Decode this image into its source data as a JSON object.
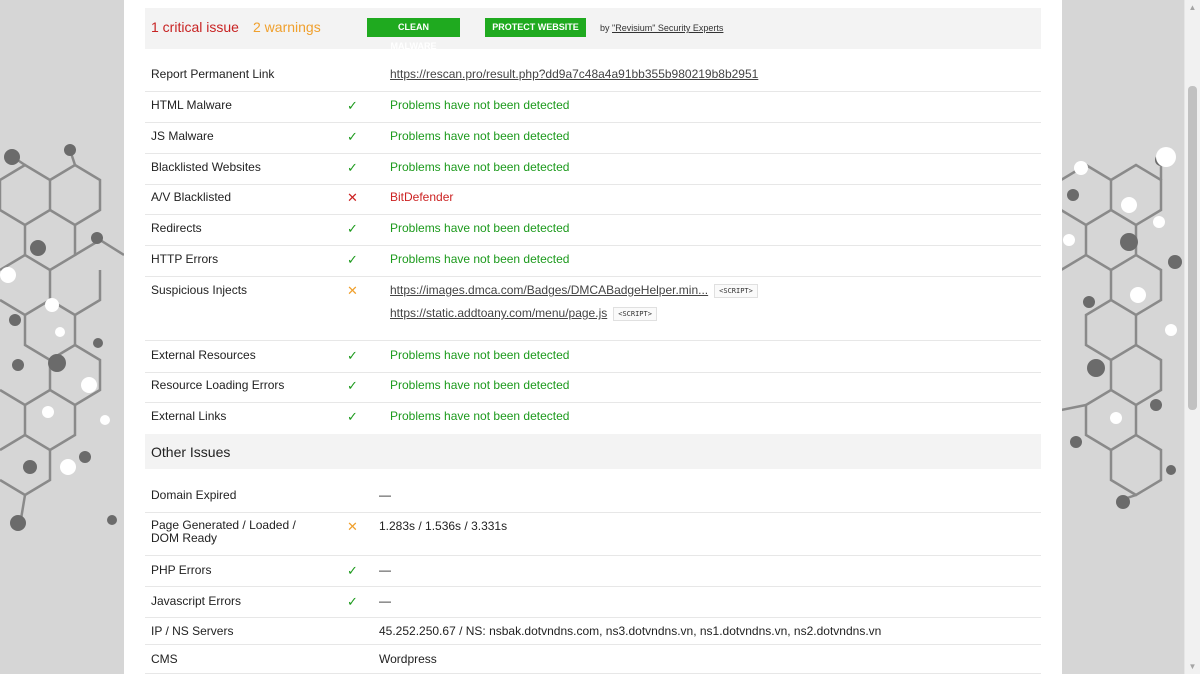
{
  "summary": {
    "critical": "1 critical issue",
    "warnings": "2 warnings",
    "clean_btn": "CLEAN MALWARE",
    "protect_btn": "PROTECT WEBSITE",
    "by_prefix": "by ",
    "by_link": "\"Revisium\" Security Experts"
  },
  "rows": [
    {
      "label": "Report Permanent Link",
      "value": "https://rescan.pro/result.php?dd9a7c48a4a91bb355b980219b8b2951"
    },
    {
      "label": "HTML Malware",
      "icon": "✓",
      "value": "Problems have not been detected"
    },
    {
      "label": "JS Malware",
      "icon": "✓",
      "value": "Problems have not been detected"
    },
    {
      "label": "Blacklisted Websites",
      "icon": "✓",
      "value": "Problems have not been detected"
    },
    {
      "label": "A/V Blacklisted",
      "icon": "✕",
      "value": "BitDefender"
    },
    {
      "label": "Redirects",
      "icon": "✓",
      "value": "Problems have not been detected"
    },
    {
      "label": "HTTP Errors",
      "icon": "✓",
      "value": "Problems have not been detected"
    },
    {
      "label": "Suspicious Injects",
      "icon": "✕",
      "link1": "https://images.dmca.com/Badges/DMCABadgeHelper.min...",
      "tag1": "<SCRIPT>",
      "link2": "https://static.addtoany.com/menu/page.js",
      "tag2": "<SCRIPT>"
    },
    {
      "label": "External Resources",
      "icon": "✓",
      "value": "Problems have not been detected"
    },
    {
      "label": "Resource Loading Errors",
      "icon": "✓",
      "value": "Problems have not been detected"
    },
    {
      "label": "External Links",
      "icon": "✓",
      "value": "Problems have not been detected"
    }
  ],
  "other_title": "Other Issues",
  "other": [
    {
      "label": "Domain Expired",
      "value": "—"
    },
    {
      "label": "Page Generated / Loaded / DOM Ready",
      "icon": "✕",
      "value": "1.283s / 1.536s / 3.331s"
    },
    {
      "label": "PHP Errors",
      "icon": "✓",
      "value": "—"
    },
    {
      "label": "Javascript Errors",
      "icon": "✓",
      "value": "—"
    },
    {
      "label": "IP / NS Servers",
      "value": "45.252.250.67 / NS: nsbak.dotvndns.com, ns3.dotvndns.vn, ns1.dotvndns.vn, ns2.dotvndns.vn"
    },
    {
      "label": "CMS",
      "value": "Wordpress"
    }
  ],
  "colors": {
    "ok": "#1c9a1c",
    "critical": "#cc2222",
    "warning": "#f0a02d",
    "button": "#1faa1f"
  }
}
